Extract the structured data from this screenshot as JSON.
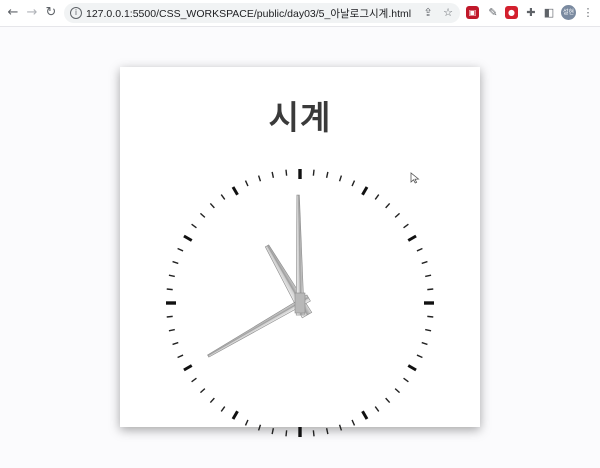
{
  "browser": {
    "url": "127.0.0.1:5500/CSS_WORKSPACE/public/day03/5_아날로그시계.html",
    "avatar_text": "설현"
  },
  "clock": {
    "title": "시계",
    "hour_hand_angle_deg": -30,
    "minute_hand_angle_deg": -1,
    "second_hand_angle_deg": 240
  }
}
